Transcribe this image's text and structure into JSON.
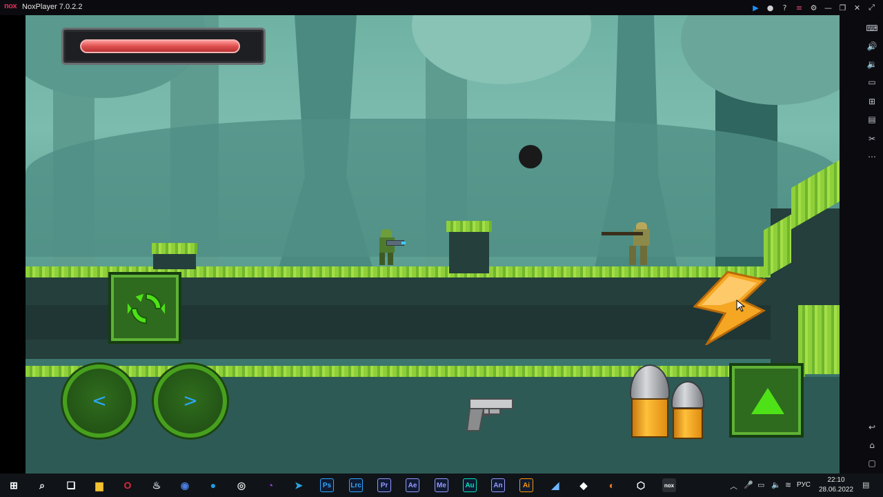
{
  "window": {
    "logo_text": "nox",
    "title": "NoxPlayer 7.0.2.2",
    "controls": [
      "play-icon",
      "mic-icon",
      "help-icon",
      "menu-icon",
      "settings-icon",
      "minimize-icon",
      "restore-icon",
      "close-icon",
      "expand-icon"
    ]
  },
  "sidebar": {
    "tools": [
      "keyboard-icon",
      "volume-up-icon",
      "volume-down-icon",
      "screen-icon",
      "apk-icon",
      "multi-instance-icon",
      "scissors-icon",
      "more-icon",
      "back-icon",
      "home-icon",
      "recent-apps-icon"
    ]
  },
  "game": {
    "player": {
      "health_fraction": 0.95
    },
    "buttons": {
      "reload": "reload-icon",
      "left": "<",
      "right": ">",
      "jump": "jump-icon",
      "special": "lightning-icon",
      "fire": "bullets-icon",
      "weapon": "pistol-icon"
    },
    "colors": {
      "health": "#e05050",
      "button_green": "#47a01d",
      "arrow_blue": "#2aa8ff",
      "bolt_orange": "#f5a623"
    }
  },
  "taskbar": {
    "apps": [
      {
        "name": "start-icon",
        "label": "",
        "color": "#ffffff"
      },
      {
        "name": "search-icon",
        "label": "",
        "color": "#ffffff"
      },
      {
        "name": "task-view-icon",
        "label": "",
        "color": "#ffffff"
      },
      {
        "name": "file-explorer-icon",
        "label": "",
        "color": "#f2c230"
      },
      {
        "name": "opera-icon",
        "label": "",
        "color": "#e0283a"
      },
      {
        "name": "steam-icon",
        "label": "",
        "color": "#c8d4e0"
      },
      {
        "name": "chrome-icon",
        "label": "",
        "color": "#4a7de0"
      },
      {
        "name": "browser-icon",
        "label": "",
        "color": "#1ea0e6"
      },
      {
        "name": "obs-icon",
        "label": "",
        "color": "#dddddd"
      },
      {
        "name": "podcast-icon",
        "label": "",
        "color": "#9b3de0"
      },
      {
        "name": "telegram-icon",
        "label": "",
        "color": "#2ca5e0"
      },
      {
        "name": "photoshop-icon",
        "label": "Ps",
        "color": "#31a8ff"
      },
      {
        "name": "lightroom-icon",
        "label": "Lrc",
        "color": "#31a8ff"
      },
      {
        "name": "premiere-icon",
        "label": "Pr",
        "color": "#9999ff"
      },
      {
        "name": "after-effects-icon",
        "label": "Ae",
        "color": "#9999ff"
      },
      {
        "name": "media-encoder-icon",
        "label": "Me",
        "color": "#9999ff"
      },
      {
        "name": "audition-icon",
        "label": "Au",
        "color": "#00e4bb"
      },
      {
        "name": "animate-icon",
        "label": "An",
        "color": "#9999ff"
      },
      {
        "name": "illustrator-icon",
        "label": "Ai",
        "color": "#ff9a00"
      },
      {
        "name": "capture-icon",
        "label": "",
        "color": "#6fb6ff"
      },
      {
        "name": "unity-icon",
        "label": "",
        "color": "#ffffff"
      },
      {
        "name": "blender-icon",
        "label": "",
        "color": "#f5792a"
      },
      {
        "name": "gear-app-icon",
        "label": "",
        "color": "#ffffff"
      },
      {
        "name": "nox-app-icon",
        "label": "nox",
        "color": "#ffffff"
      }
    ],
    "tray": {
      "lang": "РУС",
      "time": "22:10",
      "date": "28.06.2022"
    }
  }
}
